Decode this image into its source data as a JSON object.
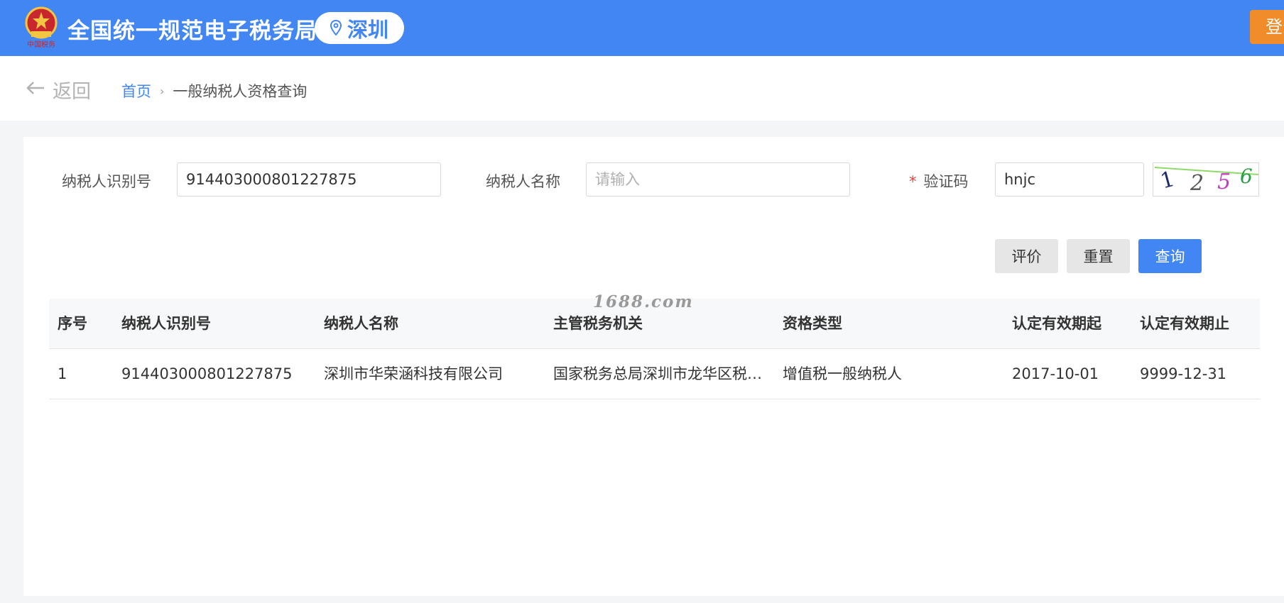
{
  "header": {
    "title": "全国统一规范电子税务局",
    "city": "深圳",
    "login_label": "登录",
    "emblem_text": "中国税务"
  },
  "breadcrumb": {
    "back_label": "返回",
    "home": "首页",
    "separator": "›",
    "current": "一般纳税人资格查询"
  },
  "form": {
    "taxpayer_id_label": "纳税人识别号",
    "taxpayer_id_value": "914403000801227875",
    "taxpayer_name_label": "纳税人名称",
    "taxpayer_name_placeholder": "请输入",
    "captcha_required": "*",
    "captcha_label": "验证码",
    "captcha_value": "hnjc",
    "captcha_image_text": "1256"
  },
  "buttons": {
    "evaluate": "评价",
    "reset": "重置",
    "search": "查询"
  },
  "watermark": "1688.com",
  "table": {
    "headers": [
      "序号",
      "纳税人识别号",
      "纳税人名称",
      "主管税务机关",
      "资格类型",
      "认定有效期起",
      "认定有效期止"
    ],
    "rows": [
      [
        "1",
        "914403000801227875",
        "深圳市华荣涵科技有限公司",
        "国家税务总局深圳市龙华区税务局",
        "增值税一般纳税人",
        "2017-10-01",
        "9999-12-31"
      ]
    ]
  },
  "colors": {
    "primary": "#4286f4",
    "login": "#f08c2a",
    "required": "#e04040"
  }
}
